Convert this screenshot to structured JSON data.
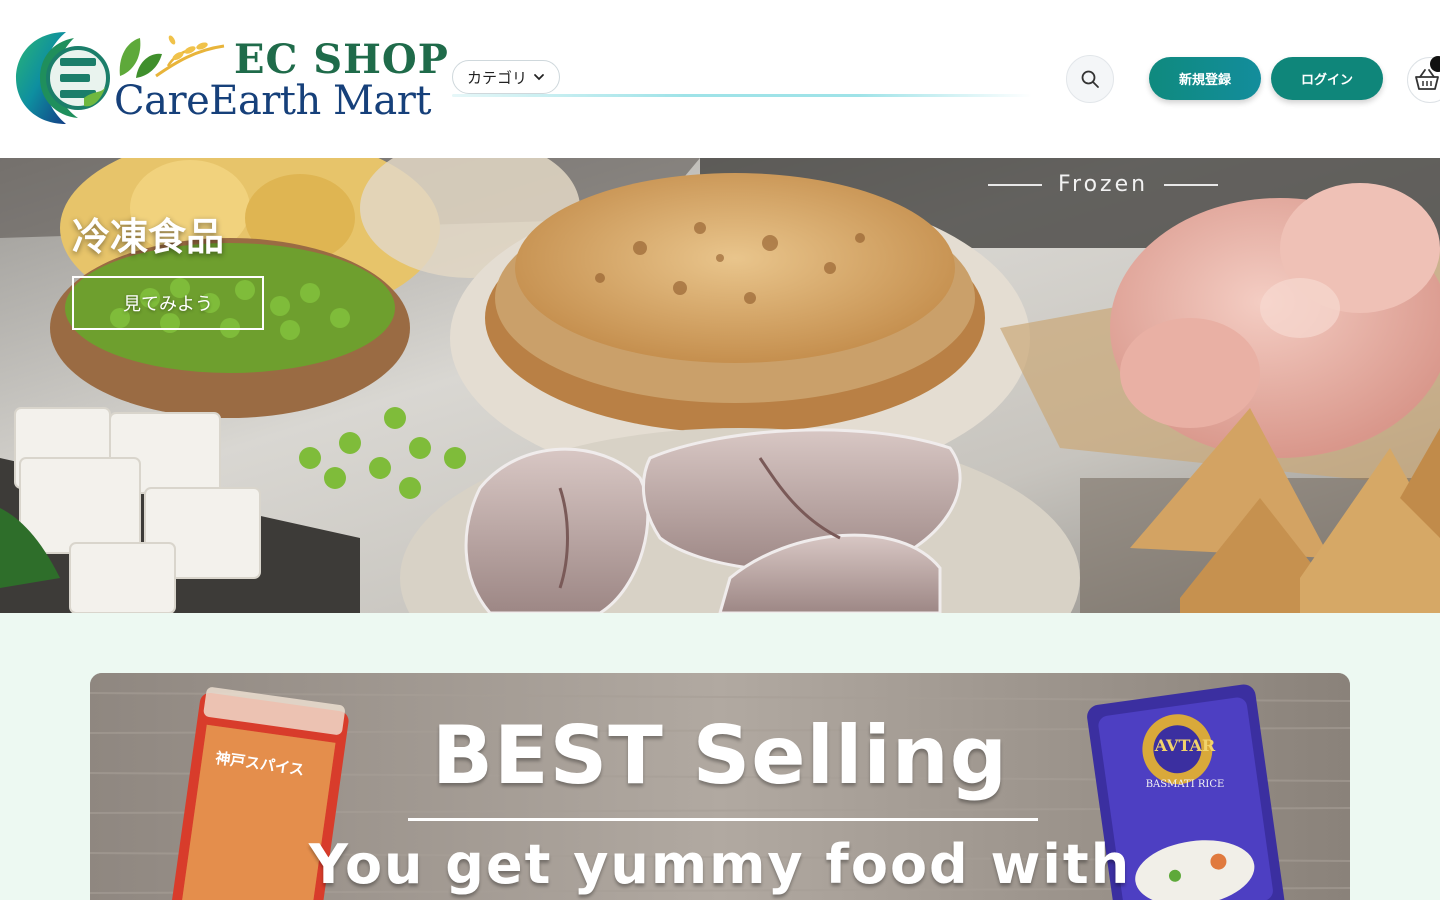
{
  "header": {
    "logo": {
      "line1": "EC SHOP",
      "line2": "CareEarth Mart"
    },
    "category_label": "カテゴリ",
    "search_placeholder": "",
    "signup_label": "新規登録",
    "login_label": "ログイン"
  },
  "hero": {
    "title": "冷凍食品",
    "cta_label": "見てみよう",
    "tagline": "Frozen"
  },
  "promo": {
    "title": "BEST Selling",
    "subtitle": "You get yummy food with",
    "left_pack_text": "神戸スパイス",
    "right_pack_brand": "AVTAR",
    "right_pack_text": "BASMATI RICE"
  },
  "colors": {
    "brand_teal": "#0f867a",
    "brand_blue": "#16407a",
    "brand_green": "#1f6b4a",
    "page_mint": "#edf9f2"
  },
  "icons": {
    "search": "search-icon",
    "cart": "basket-icon",
    "chevron": "chevron-down-icon"
  }
}
